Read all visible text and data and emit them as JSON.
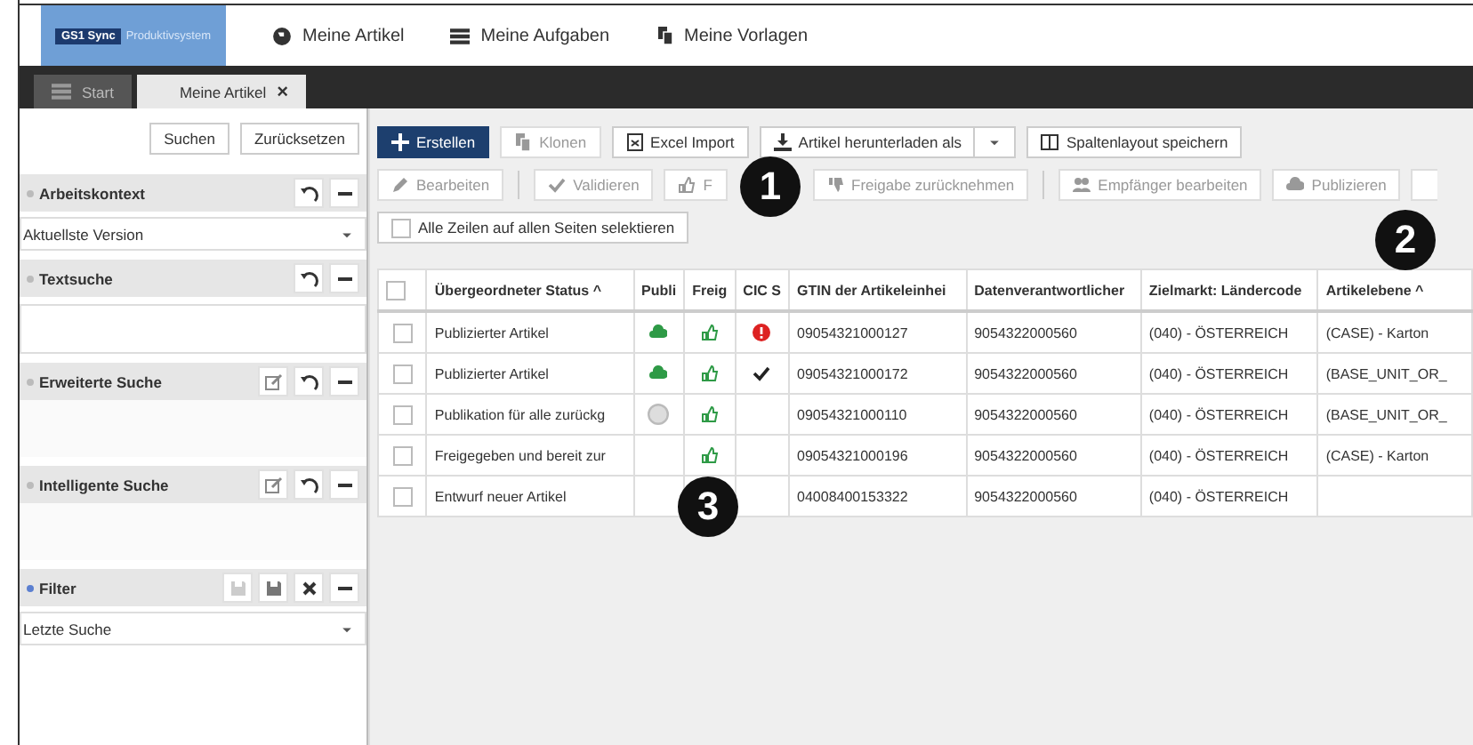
{
  "nav": {
    "logo_badge": "GS1 Sync",
    "logo_text": "Produktivsystem",
    "items": [
      {
        "label": "Meine Artikel"
      },
      {
        "label": "Meine Aufgaben"
      },
      {
        "label": "Meine Vorlagen"
      }
    ]
  },
  "tabs": [
    {
      "label": "Start",
      "selected": false
    },
    {
      "label": "Meine Artikel",
      "selected": true,
      "close": "×"
    }
  ],
  "sidebar": {
    "buttons": [
      "Suchen",
      "Zurücksetzen"
    ],
    "sections": [
      {
        "title": "Arbeitskontext",
        "active": false,
        "kind": "select",
        "value": "Aktuellste Version"
      },
      {
        "title": "Textsuche",
        "active": false,
        "kind": "input"
      },
      {
        "title": "Erweiterte Suche",
        "active": false,
        "kind": "empty"
      },
      {
        "title": "Intelligente Suche",
        "active": false,
        "kind": "empty"
      },
      {
        "title": "Filter",
        "active": true,
        "kind": "select",
        "value": "Letzte Suche"
      }
    ]
  },
  "toolbar": {
    "row1": [
      {
        "label": "Erstellen",
        "kind": "primary",
        "disabled": false
      },
      {
        "label": "Klonen",
        "kind": "normal",
        "disabled": true
      },
      {
        "label": "Excel Import",
        "kind": "normal",
        "disabled": false
      },
      {
        "label": "Artikel herunterladen als",
        "kind": "split",
        "disabled": false
      },
      {
        "label": "Spaltenlayout speichern",
        "kind": "normal",
        "disabled": false
      }
    ],
    "row2": [
      {
        "label": "Bearbeiten",
        "kind": "normal",
        "disabled": true
      },
      {
        "kind": "separator"
      },
      {
        "label": "Validieren",
        "kind": "normal",
        "disabled": true
      },
      {
        "label": "F",
        "kind": "normal",
        "disabled": true
      },
      {
        "label": "Freigabe zurücknehmen",
        "kind": "normal",
        "disabled": true
      },
      {
        "kind": "separator"
      },
      {
        "label": "Empfänger bearbeiten",
        "kind": "normal",
        "disabled": true
      },
      {
        "label": "Publizieren",
        "kind": "normal",
        "disabled": true
      },
      {
        "kind": "partial",
        "disabled": true
      }
    ],
    "select_all": {
      "label": "Alle Zeilen auf allen Seiten selektieren",
      "checked": false
    }
  },
  "table": {
    "all_selected": false,
    "columns": [
      "Übergeordneter Status ^",
      "Publi",
      "Freig",
      "CIC S",
      "GTIN der Artikeleinhei",
      "Datenverantwortlicher",
      "Zielmarkt: Ländercode",
      "Artikelebene ^"
    ],
    "rows": [
      {
        "selected": false,
        "status": "Publizierter Artikel",
        "published": true,
        "withdrawn": false,
        "approved": true,
        "cic_error": true,
        "cic_ok": false,
        "gtin": "09054321000127",
        "owner": "9054322000560",
        "market": "(040) - ÖSTERREICH",
        "level_text": "(CASE) - Karton"
      },
      {
        "selected": false,
        "status": "Publizierter Artikel",
        "published": true,
        "withdrawn": false,
        "approved": true,
        "cic_error": false,
        "cic_ok": true,
        "gtin": "09054321000172",
        "owner": "9054322000560",
        "market": "(040) - ÖSTERREICH",
        "level_text": "(BASE_UNIT_OR_"
      },
      {
        "selected": false,
        "status": "Publikation für alle zurückg",
        "published": false,
        "withdrawn": true,
        "approved": true,
        "cic_error": false,
        "cic_ok": false,
        "gtin": "09054321000110",
        "owner": "9054322000560",
        "market": "(040) - ÖSTERREICH",
        "level_text": "(BASE_UNIT_OR_"
      },
      {
        "selected": false,
        "status": "Freigegeben und bereit zur",
        "published": false,
        "withdrawn": false,
        "approved": true,
        "cic_error": false,
        "cic_ok": false,
        "gtin": "09054321000196",
        "owner": "9054322000560",
        "market": "(040) - ÖSTERREICH",
        "level_text": "(CASE) - Karton"
      },
      {
        "selected": false,
        "status": "Entwurf neuer Artikel",
        "published": false,
        "withdrawn": false,
        "approved": false,
        "cic_error": false,
        "cic_ok": false,
        "gtin": "04008400153322",
        "owner": "9054322000560",
        "market": "(040) - ÖSTERREICH"
      }
    ]
  },
  "callouts": [
    "1",
    "2",
    "3"
  ]
}
